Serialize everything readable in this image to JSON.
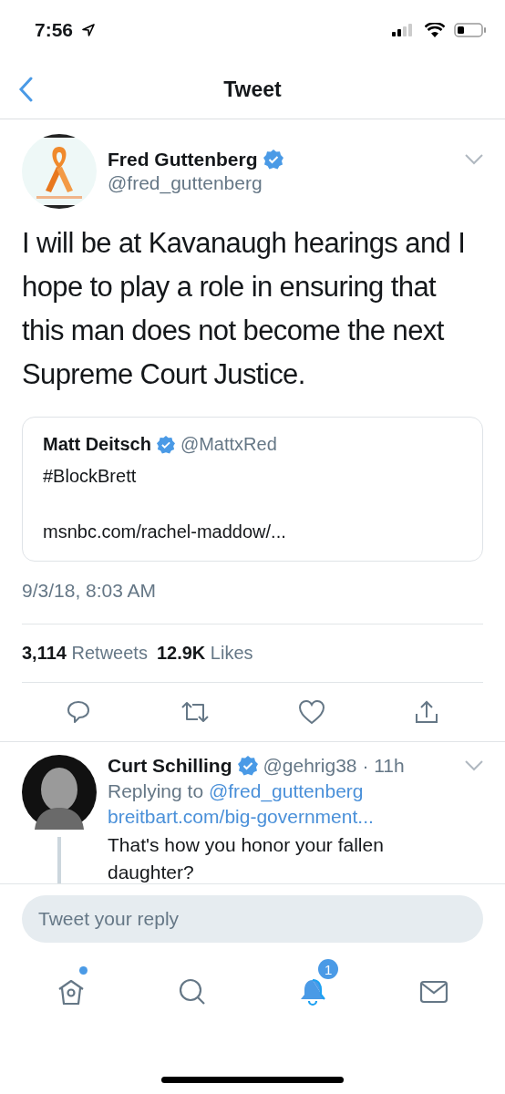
{
  "status_bar": {
    "time": "7:56"
  },
  "nav": {
    "title": "Tweet"
  },
  "tweet": {
    "author": {
      "name": "Fred Guttenberg",
      "handle": "@fred_guttenberg",
      "verified": true
    },
    "text": "I will be at Kavanaugh hearings and I hope to play a role in ensuring that this man does not become the next Supreme Court Justice.",
    "quote": {
      "name": "Matt Deitsch",
      "verified": true,
      "handle": "@MattxRed",
      "text": "#BlockBrett",
      "link": "msnbc.com/rachel-maddow/..."
    },
    "timestamp": "9/3/18, 8:03 AM",
    "stats": [
      {
        "count": "3,114",
        "label": "Retweets"
      },
      {
        "count": "12.9K",
        "label": "Likes"
      }
    ]
  },
  "reply": {
    "name": "Curt Schilling",
    "verified": true,
    "meta": "@gehrig38 · 11h",
    "replying_prefix": "Replying to",
    "replying_to": "@fred_guttenberg",
    "link": "breitbart.com/big-government...",
    "text": "That's how you honor your fallen daughter?"
  },
  "composer": {
    "placeholder": "Tweet your reply"
  },
  "tab_bar": [
    {
      "kind": "home",
      "selected": false,
      "dot": true
    },
    {
      "kind": "search",
      "selected": false
    },
    {
      "kind": "notifications",
      "selected": true,
      "badge": "1"
    },
    {
      "kind": "messages",
      "selected": false
    }
  ]
}
